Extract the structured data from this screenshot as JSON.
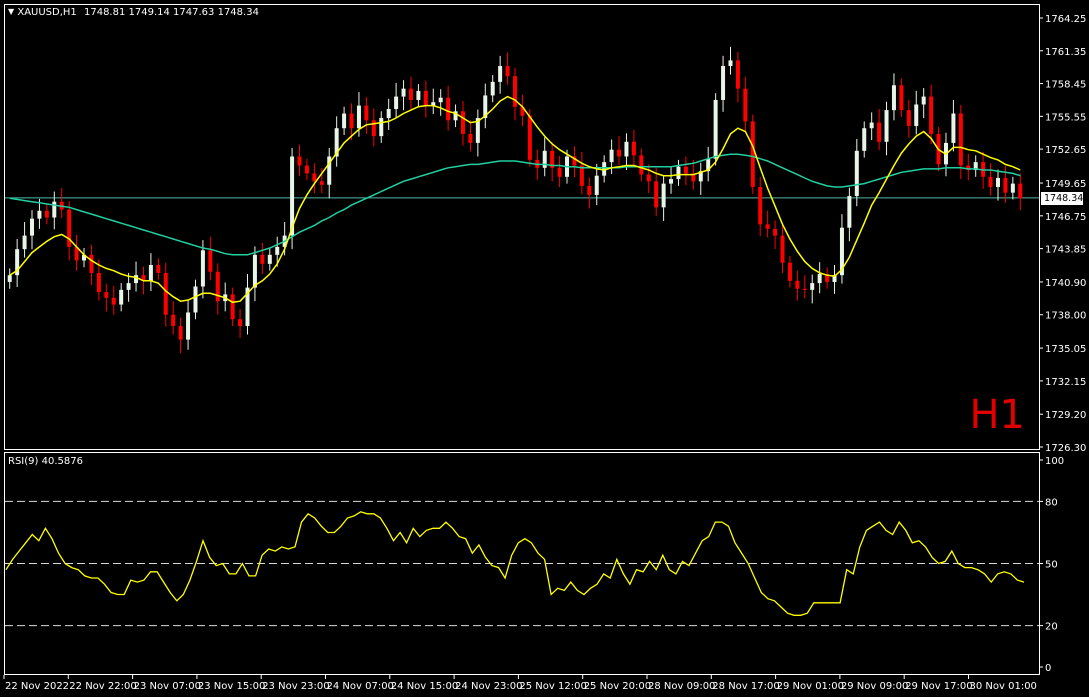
{
  "header": {
    "symbol_label": "XAUUSD,H1",
    "ohlc": "1748.81 1749.14 1747.63 1748.34"
  },
  "timeframe_badge": "H1",
  "current_price": "1748.34",
  "rsi_header": "RSI(9) 40.5876",
  "colors": {
    "background": "#000000",
    "bull": "#e8f5e8",
    "bear": "#ff0000",
    "ma_fast": "#ffff00",
    "ma_slow": "#20d0a0",
    "rsi": "#ffff00",
    "grid_axis": "#ffffff",
    "price_line": "#4fb8a8"
  },
  "chart_data": [
    {
      "type": "candlestick",
      "title": "XAUUSD,H1",
      "ylim": [
        1726.3,
        1764.25
      ],
      "y_ticks": [
        "1764.25",
        "1761.35",
        "1758.45",
        "1755.55",
        "1752.65",
        "1749.65",
        "1746.75",
        "1743.85",
        "1740.90",
        "1738.00",
        "1735.05",
        "1732.15",
        "1729.20",
        "1726.30"
      ],
      "x_ticks": [
        "22 Nov 2022",
        "22 Nov 22:00",
        "23 Nov 07:00",
        "23 Nov 15:00",
        "23 Nov 23:00",
        "24 Nov 07:00",
        "24 Nov 15:00",
        "24 Nov 23:00",
        "25 Nov 12:00",
        "25 Nov 20:00",
        "28 Nov 09:00",
        "28 Nov 17:00",
        "29 Nov 01:00",
        "29 Nov 09:00",
        "29 Nov 17:00",
        "30 Nov 01:00"
      ],
      "series": [
        {
          "name": "Close",
          "values": [
            1741.5,
            1743.8,
            1745.0,
            1746.5,
            1747.2,
            1746.6,
            1748.0,
            1747.3,
            1744.0,
            1742.8,
            1743.3,
            1741.7,
            1740.0,
            1739.5,
            1738.9,
            1740.2,
            1740.8,
            1741.5,
            1741.0,
            1742.4,
            1741.7,
            1738.0,
            1737.0,
            1735.8,
            1738.2,
            1740.5,
            1743.7,
            1741.8,
            1739.2,
            1739.8,
            1737.6,
            1737.0,
            1740.4,
            1743.3,
            1742.5,
            1743.3,
            1744.0,
            1745.0,
            1752.0,
            1751.2,
            1750.5,
            1749.8,
            1749.5,
            1752.0,
            1754.5,
            1755.8,
            1754.5,
            1756.5,
            1755.2,
            1753.8,
            1755.4,
            1756.2,
            1757.3,
            1758.0,
            1757.0,
            1757.8,
            1756.5,
            1756.8,
            1757.2,
            1755.2,
            1756.0,
            1754.0,
            1753.2,
            1755.4,
            1757.4,
            1758.6,
            1760.0,
            1759.1,
            1756.4,
            1755.6,
            1751.7,
            1751.0,
            1752.5,
            1751.0,
            1750.2,
            1752.0,
            1751.2,
            1749.4,
            1748.6,
            1750.3,
            1751.5,
            1752.6,
            1752.0,
            1753.3,
            1752.1,
            1750.4,
            1749.8,
            1747.5,
            1749.6,
            1750.0,
            1751.1,
            1750.5,
            1749.8,
            1750.7,
            1751.8,
            1757.0,
            1760.0,
            1760.5,
            1758.0,
            1755.1,
            1749.3,
            1746.0,
            1745.6,
            1745.0,
            1742.6,
            1741.0,
            1740.3,
            1740.2,
            1740.8,
            1741.6,
            1740.9,
            1741.5,
            1745.7,
            1748.5,
            1752.5,
            1754.5,
            1755.0,
            1753.3,
            1756.1,
            1758.3,
            1756.1,
            1754.7,
            1756.6,
            1757.3,
            1754.0,
            1751.3,
            1753.2,
            1755.8,
            1751.2,
            1750.8,
            1751.5,
            1750.2,
            1749.3,
            1750.1,
            1748.8,
            1749.6,
            1748.3
          ]
        }
      ],
      "ma_fast": {
        "name": "",
        "values": [
          1741.5,
          1741.9,
          1742.7,
          1743.5,
          1744.0,
          1744.5,
          1744.9,
          1745.1,
          1744.7,
          1744.0,
          1743.3,
          1742.8,
          1742.4,
          1742.1,
          1741.9,
          1741.6,
          1741.4,
          1741.3,
          1741.0,
          1741.0,
          1740.8,
          1740.1,
          1739.6,
          1739.2,
          1739.3,
          1739.6,
          1739.9,
          1739.9,
          1739.7,
          1739.5,
          1739.1,
          1739.2,
          1739.9,
          1740.6,
          1741.0,
          1741.6,
          1742.5,
          1743.8,
          1745.7,
          1747.4,
          1748.6,
          1749.6,
          1750.5,
          1751.4,
          1752.3,
          1753.2,
          1753.8,
          1754.4,
          1754.8,
          1754.9,
          1755.0,
          1755.1,
          1755.4,
          1755.8,
          1756.1,
          1756.4,
          1756.5,
          1756.5,
          1756.3,
          1756.0,
          1755.8,
          1755.4,
          1755.0,
          1755.1,
          1755.6,
          1756.2,
          1756.9,
          1757.3,
          1757.0,
          1756.4,
          1755.5,
          1754.6,
          1753.8,
          1753.1,
          1752.6,
          1752.2,
          1751.8,
          1751.4,
          1751.1,
          1750.9,
          1750.8,
          1751.0,
          1751.1,
          1751.2,
          1751.2,
          1751.0,
          1750.8,
          1750.5,
          1750.3,
          1750.3,
          1750.4,
          1750.4,
          1750.4,
          1750.6,
          1750.8,
          1751.5,
          1752.7,
          1754.0,
          1754.5,
          1754.2,
          1752.9,
          1751.0,
          1749.2,
          1747.6,
          1746.0,
          1744.7,
          1743.6,
          1742.7,
          1742.1,
          1741.7,
          1741.5,
          1741.4,
          1742.0,
          1743.1,
          1744.6,
          1746.1,
          1747.7,
          1748.8,
          1750.0,
          1751.2,
          1752.3,
          1753.1,
          1753.8,
          1754.2,
          1753.6,
          1752.6,
          1752.2,
          1752.8,
          1752.8,
          1752.6,
          1752.5,
          1752.2,
          1751.9,
          1751.7,
          1751.3,
          1751.1,
          1750.8
        ]
      },
      "ma_slow": {
        "name": "",
        "values": [
          1748.3,
          1748.2,
          1748.1,
          1748.0,
          1747.9,
          1747.8,
          1747.7,
          1747.6,
          1747.5,
          1747.3,
          1747.1,
          1746.9,
          1746.7,
          1746.5,
          1746.3,
          1746.1,
          1745.9,
          1745.7,
          1745.5,
          1745.3,
          1745.1,
          1744.9,
          1744.7,
          1744.5,
          1744.3,
          1744.1,
          1743.9,
          1743.8,
          1743.6,
          1743.4,
          1743.3,
          1743.3,
          1743.3,
          1743.5,
          1743.7,
          1743.9,
          1744.2,
          1744.5,
          1744.9,
          1745.3,
          1745.6,
          1745.9,
          1746.3,
          1746.6,
          1747.0,
          1747.3,
          1747.7,
          1748.0,
          1748.3,
          1748.6,
          1748.9,
          1749.2,
          1749.5,
          1749.8,
          1750.0,
          1750.2,
          1750.4,
          1750.6,
          1750.8,
          1751.0,
          1751.1,
          1751.2,
          1751.3,
          1751.3,
          1751.4,
          1751.5,
          1751.6,
          1751.6,
          1751.6,
          1751.5,
          1751.4,
          1751.3,
          1751.3,
          1751.2,
          1751.2,
          1751.1,
          1751.1,
          1751.0,
          1751.0,
          1751.0,
          1751.0,
          1751.0,
          1751.0,
          1751.1,
          1751.1,
          1751.1,
          1751.1,
          1751.1,
          1751.1,
          1751.1,
          1751.2,
          1751.3,
          1751.4,
          1751.6,
          1751.8,
          1752.0,
          1752.1,
          1752.2,
          1752.2,
          1752.1,
          1752.0,
          1751.8,
          1751.6,
          1751.3,
          1751.0,
          1750.7,
          1750.4,
          1750.1,
          1749.8,
          1749.6,
          1749.4,
          1749.3,
          1749.3,
          1749.4,
          1749.5,
          1749.6,
          1749.8,
          1750.0,
          1750.2,
          1750.4,
          1750.6,
          1750.7,
          1750.8,
          1750.9,
          1750.9,
          1750.9,
          1751.0,
          1751.0,
          1751.0,
          1750.9,
          1750.9,
          1750.8,
          1750.8,
          1750.7,
          1750.6,
          1750.5,
          1750.3
        ]
      },
      "price_line": 1748.34
    },
    {
      "type": "line",
      "title": "RSI(9) 40.5876",
      "ylim": [
        0,
        100
      ],
      "y_ticks": [
        "100",
        "80",
        "50",
        "20",
        "0"
      ],
      "levels": [
        80,
        50,
        20
      ],
      "series": [
        {
          "name": "RSI(9)",
          "values": [
            47,
            52,
            56,
            60,
            64,
            61,
            67,
            62,
            55,
            50,
            48,
            47,
            44,
            43,
            43,
            40,
            36,
            35,
            35,
            42,
            41,
            42,
            46,
            46,
            41,
            36,
            32,
            35,
            42,
            51,
            61,
            53,
            49,
            50,
            45,
            45,
            50,
            44,
            44,
            54,
            57,
            56,
            58,
            57,
            58,
            70,
            74,
            72,
            68,
            65,
            65,
            68,
            72,
            73,
            75,
            74,
            74,
            72,
            67,
            61,
            65,
            60,
            67,
            63,
            66,
            67,
            67,
            70,
            67,
            63,
            62,
            55,
            59,
            53,
            49,
            48,
            43,
            54,
            60,
            62,
            60,
            55,
            52,
            35,
            38,
            37,
            41,
            37,
            35,
            38,
            40,
            45,
            43,
            52,
            45,
            40,
            47,
            46,
            51,
            47,
            54,
            47,
            45,
            51,
            49,
            55,
            61,
            63,
            70,
            70,
            68,
            60,
            55,
            50,
            43,
            36,
            33,
            32,
            29,
            26,
            25,
            25,
            26,
            31,
            31,
            31,
            31,
            31,
            47,
            45,
            58,
            66,
            68,
            70,
            66,
            64,
            70,
            66,
            60,
            61,
            58,
            53,
            50,
            51,
            56,
            50,
            48,
            48,
            47,
            45,
            41,
            45,
            46,
            45,
            42,
            41
          ]
        }
      ],
      "current_value": 40.5876
    }
  ]
}
